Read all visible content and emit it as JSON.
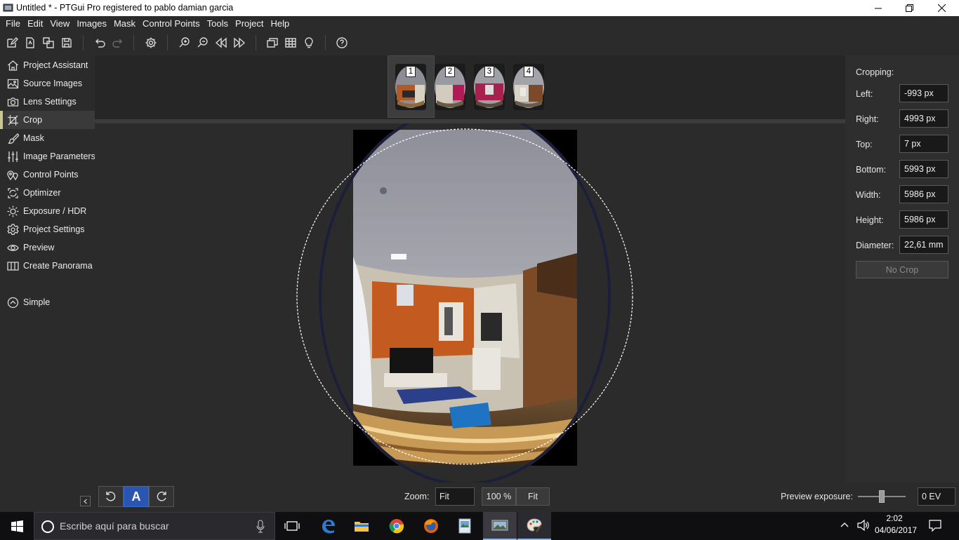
{
  "window": {
    "title": "Untitled * - PTGui Pro registered to pablo damian garcia"
  },
  "menu": [
    "File",
    "Edit",
    "View",
    "Images",
    "Mask",
    "Control Points",
    "Tools",
    "Project",
    "Help"
  ],
  "toolbar": {
    "icons": [
      "new-project-icon",
      "open-project-icon",
      "duplicate-icon",
      "save-icon",
      "undo-icon",
      "redo-icon",
      "settings-icon",
      "zoom-in-icon",
      "zoom-out-icon",
      "previous-icon",
      "next-icon",
      "panorama-editor-icon",
      "table-icon",
      "lightbulb-icon",
      "help-icon"
    ]
  },
  "sidebar": {
    "items": [
      {
        "label": "Project Assistant",
        "icon": "home-icon"
      },
      {
        "label": "Source Images",
        "icon": "image-icon"
      },
      {
        "label": "Lens Settings",
        "icon": "camera-icon"
      },
      {
        "label": "Crop",
        "icon": "crop-icon",
        "active": true
      },
      {
        "label": "Mask",
        "icon": "brush-icon"
      },
      {
        "label": "Image Parameters",
        "icon": "sliders-icon"
      },
      {
        "label": "Control Points",
        "icon": "control-points-icon"
      },
      {
        "label": "Optimizer",
        "icon": "optimizer-icon"
      },
      {
        "label": "Exposure / HDR",
        "icon": "sun-icon"
      },
      {
        "label": "Project Settings",
        "icon": "gear-icon"
      },
      {
        "label": "Preview",
        "icon": "eye-icon"
      },
      {
        "label": "Create Panorama",
        "icon": "panorama-icon"
      }
    ],
    "simple_label": "Simple"
  },
  "thumbnails": [
    {
      "number": "1",
      "selected": true
    },
    {
      "number": "2"
    },
    {
      "number": "3"
    },
    {
      "number": "4"
    }
  ],
  "cropping": {
    "heading": "Cropping:",
    "fields": [
      {
        "label": "Left:",
        "value": "-993 px"
      },
      {
        "label": "Right:",
        "value": "4993 px"
      },
      {
        "label": "Top:",
        "value": "7 px"
      },
      {
        "label": "Bottom:",
        "value": "5993 px"
      },
      {
        "label": "Width:",
        "value": "5986 px"
      },
      {
        "label": "Height:",
        "value": "5986 px"
      },
      {
        "label": "Diameter:",
        "value": "22,61 mm"
      }
    ],
    "no_crop_label": "No Crop"
  },
  "bottom": {
    "auto_label": "A",
    "zoom_label": "Zoom:",
    "zoom_value": "Fit",
    "zoom_100_label": "100 %",
    "zoom_fit_label": "Fit",
    "preview_exposure_label": "Preview exposure:",
    "preview_exposure_value": "0 EV",
    "preview_exposure_level": 0.5
  },
  "taskbar": {
    "search_placeholder": "Escribe aquí para buscar",
    "time": "2:02",
    "date": "04/06/2017",
    "colors": {
      "accent": "#2b7bd6"
    }
  }
}
